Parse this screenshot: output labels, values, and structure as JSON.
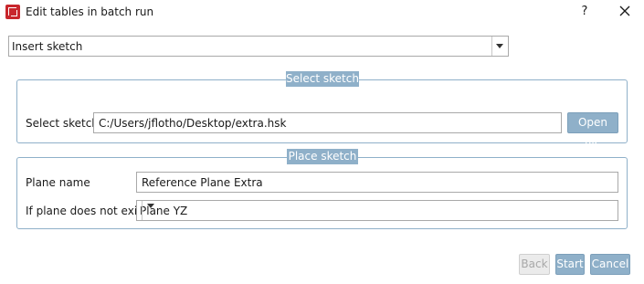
{
  "window": {
    "title": "Edit tables in batch run",
    "app_icon": "app-logo-icon",
    "help_label": "?",
    "close_icon": "close-icon"
  },
  "mode_select": {
    "value": "Insert sketch",
    "arrow_icon": "chevron-down-icon"
  },
  "select_sketch_group": {
    "title": "Select sketch",
    "field_label": "Select sketch",
    "field_value": "C:/Users/jflotho/Desktop/extra.hsk",
    "open_button": "Open file"
  },
  "place_sketch_group": {
    "title": "Place sketch",
    "plane_name_label": "Plane name",
    "plane_name_value": "Reference Plane Extra",
    "fallback_label": "If plane does not exist",
    "fallback_value": "Plane YZ",
    "arrow_icon": "chevron-down-icon"
  },
  "footer": {
    "back_button": "Back",
    "start_button": "Start",
    "cancel_button": "Cancel"
  },
  "colors": {
    "accent": "#8fb0c9",
    "brand_red": "#c8262c",
    "disabled_bg": "#ebebeb"
  }
}
